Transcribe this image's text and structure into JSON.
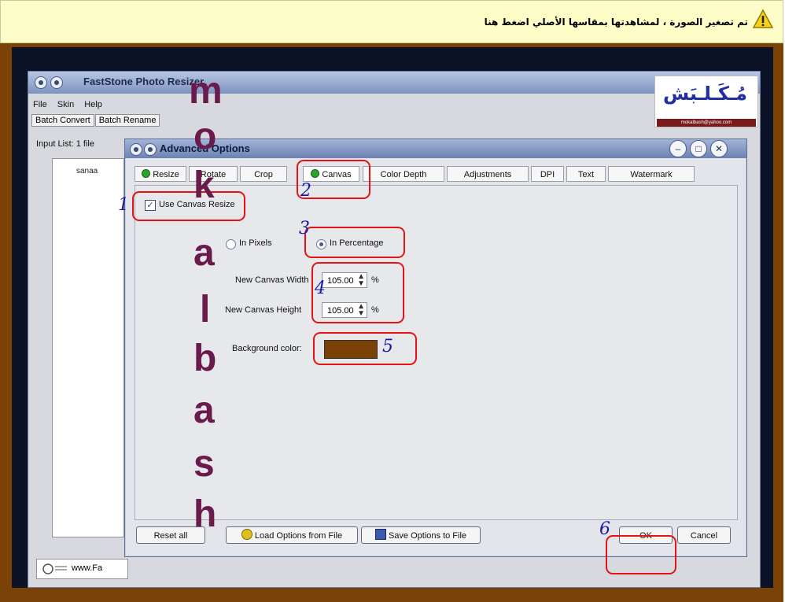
{
  "notice": {
    "text": "تم تصغير الصورة ، لمشاهدتها بمقاسها الأصلي اضغط هنا"
  },
  "main_window": {
    "title": "FastStone Photo Resizer",
    "menu": [
      "File",
      "Skin",
      "Help"
    ],
    "tabs": [
      "Batch Convert",
      "Batch Rename"
    ],
    "input_list_label": "Input List: 1 file",
    "tree_item": "sanaa",
    "status_text": "www.Fa"
  },
  "logo": {
    "text": "مُـكَـلـبَش",
    "sub": "mokalbash@yahoo.com"
  },
  "watermark": {
    "letters": [
      "m",
      "o",
      "k",
      "a",
      "l",
      "b",
      "a",
      "s",
      "h"
    ]
  },
  "dialog": {
    "title": "Advanced Options",
    "tabs": [
      "Resize",
      "Rotate",
      "Crop",
      "Canvas",
      "Color Depth",
      "Adjustments",
      "DPI",
      "Text",
      "Watermark"
    ],
    "use_canvas_resize": "Use Canvas Resize",
    "in_pixels": "In Pixels",
    "in_percentage": "In Percentage",
    "new_width_label": "New Canvas Width",
    "new_height_label": "New Canvas Height",
    "width_value": "105.00",
    "height_value": "105.00",
    "unit": "%",
    "bg_color_label": "Background color:",
    "bg_color": "#7b4208",
    "buttons": {
      "reset": "Reset all",
      "load": "Load Options from File",
      "save": "Save Options to File",
      "ok": "OK",
      "cancel": "Cancel"
    }
  },
  "annotations": [
    "1",
    "2",
    "3",
    "4",
    "5",
    "6"
  ]
}
